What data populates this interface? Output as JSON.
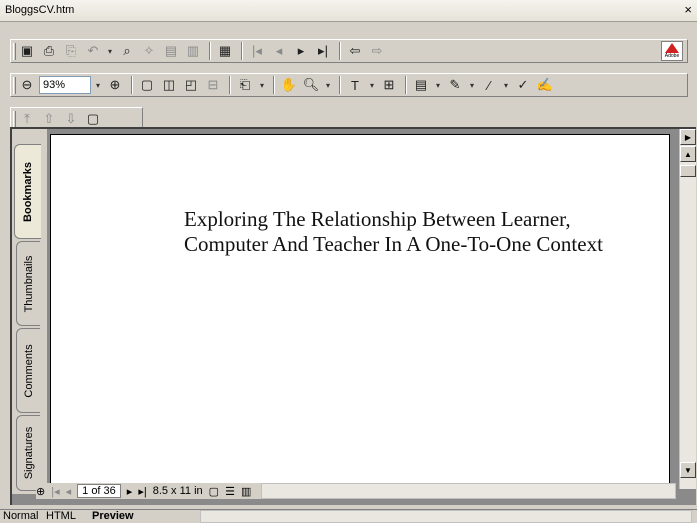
{
  "window": {
    "title": "BloggsCV.htm",
    "close_label": "×"
  },
  "toolbar1": {
    "buttons": [
      {
        "name": "save-icon",
        "glyph": "💾"
      },
      {
        "name": "print-icon",
        "glyph": "🖨"
      },
      {
        "name": "copy-icon",
        "glyph": "⎘"
      },
      {
        "name": "undo-icon",
        "glyph": "↶"
      },
      {
        "name": "find-icon",
        "glyph": "⌕"
      },
      {
        "name": "first-page-icon",
        "glyph": "|◀"
      },
      {
        "name": "prev-page-icon",
        "glyph": "◀"
      },
      {
        "name": "next-page-icon",
        "glyph": "▶"
      },
      {
        "name": "last-page-icon",
        "glyph": "▶|"
      },
      {
        "name": "back-icon",
        "glyph": "⇦"
      },
      {
        "name": "forward-icon",
        "glyph": "⇨"
      }
    ]
  },
  "toolbar2": {
    "zoom_value": "93%"
  },
  "nav_tabs": [
    {
      "label": "Bookmarks"
    },
    {
      "label": "Thumbnails"
    },
    {
      "label": "Comments"
    },
    {
      "label": "Signatures"
    }
  ],
  "document": {
    "title_text": "Exploring The Relationship Between Learner, Computer And Teacher In A One-To-One Context"
  },
  "status": {
    "page_indicator": "1 of 36",
    "page_size": "8.5 x 11 in"
  },
  "bottom_tabs": [
    {
      "label": "Normal"
    },
    {
      "label": "HTML"
    },
    {
      "label": "Preview"
    }
  ]
}
